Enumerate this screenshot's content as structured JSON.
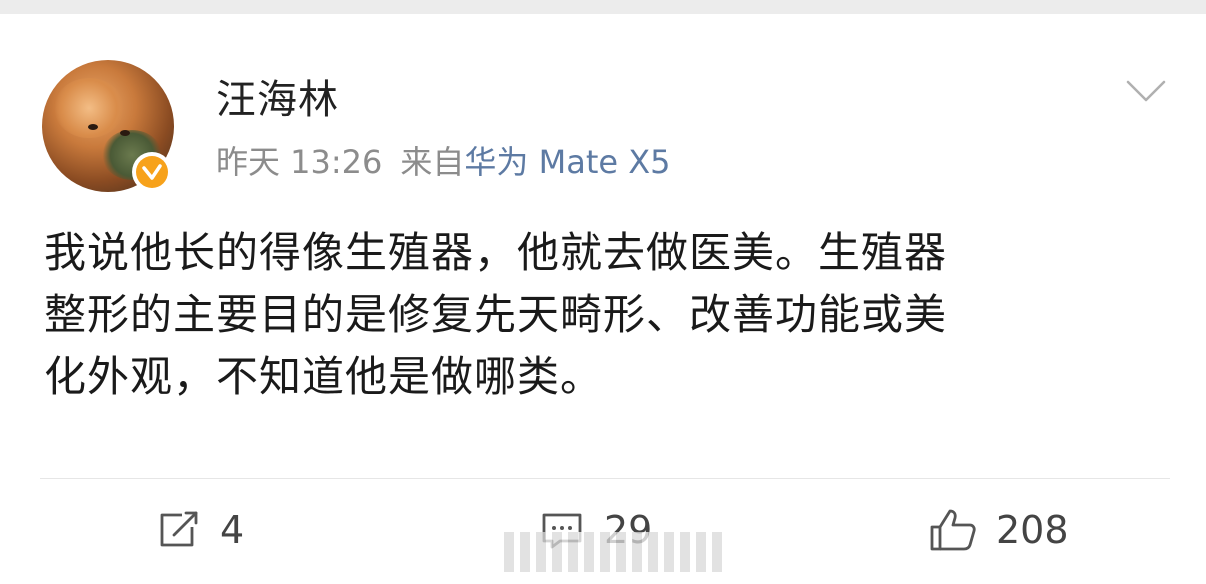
{
  "post": {
    "author": "汪海林",
    "time": "昨天 13:26",
    "source_prefix": "来自",
    "source_device": "华为 Mate X5",
    "body_lines": [
      "我说他长的得像生殖器，他就去做医美。生殖器",
      "整形的主要目的是修复先天畸形、改善功能或美",
      "化外观，不知道他是做哪类。"
    ]
  },
  "actions": {
    "repost_count": "4",
    "comment_count": "29",
    "like_count": "208"
  },
  "icons": {
    "avatar": "cat-avatar",
    "verified": "verified-badge-icon",
    "menu": "chevron-down-icon",
    "repost": "repost-icon",
    "comment": "comment-icon",
    "like": "thumbs-up-icon"
  },
  "colors": {
    "verified_badge": "#f7a21b",
    "source_device": "#5d7aa3",
    "meta_text": "#8c8c8c"
  }
}
